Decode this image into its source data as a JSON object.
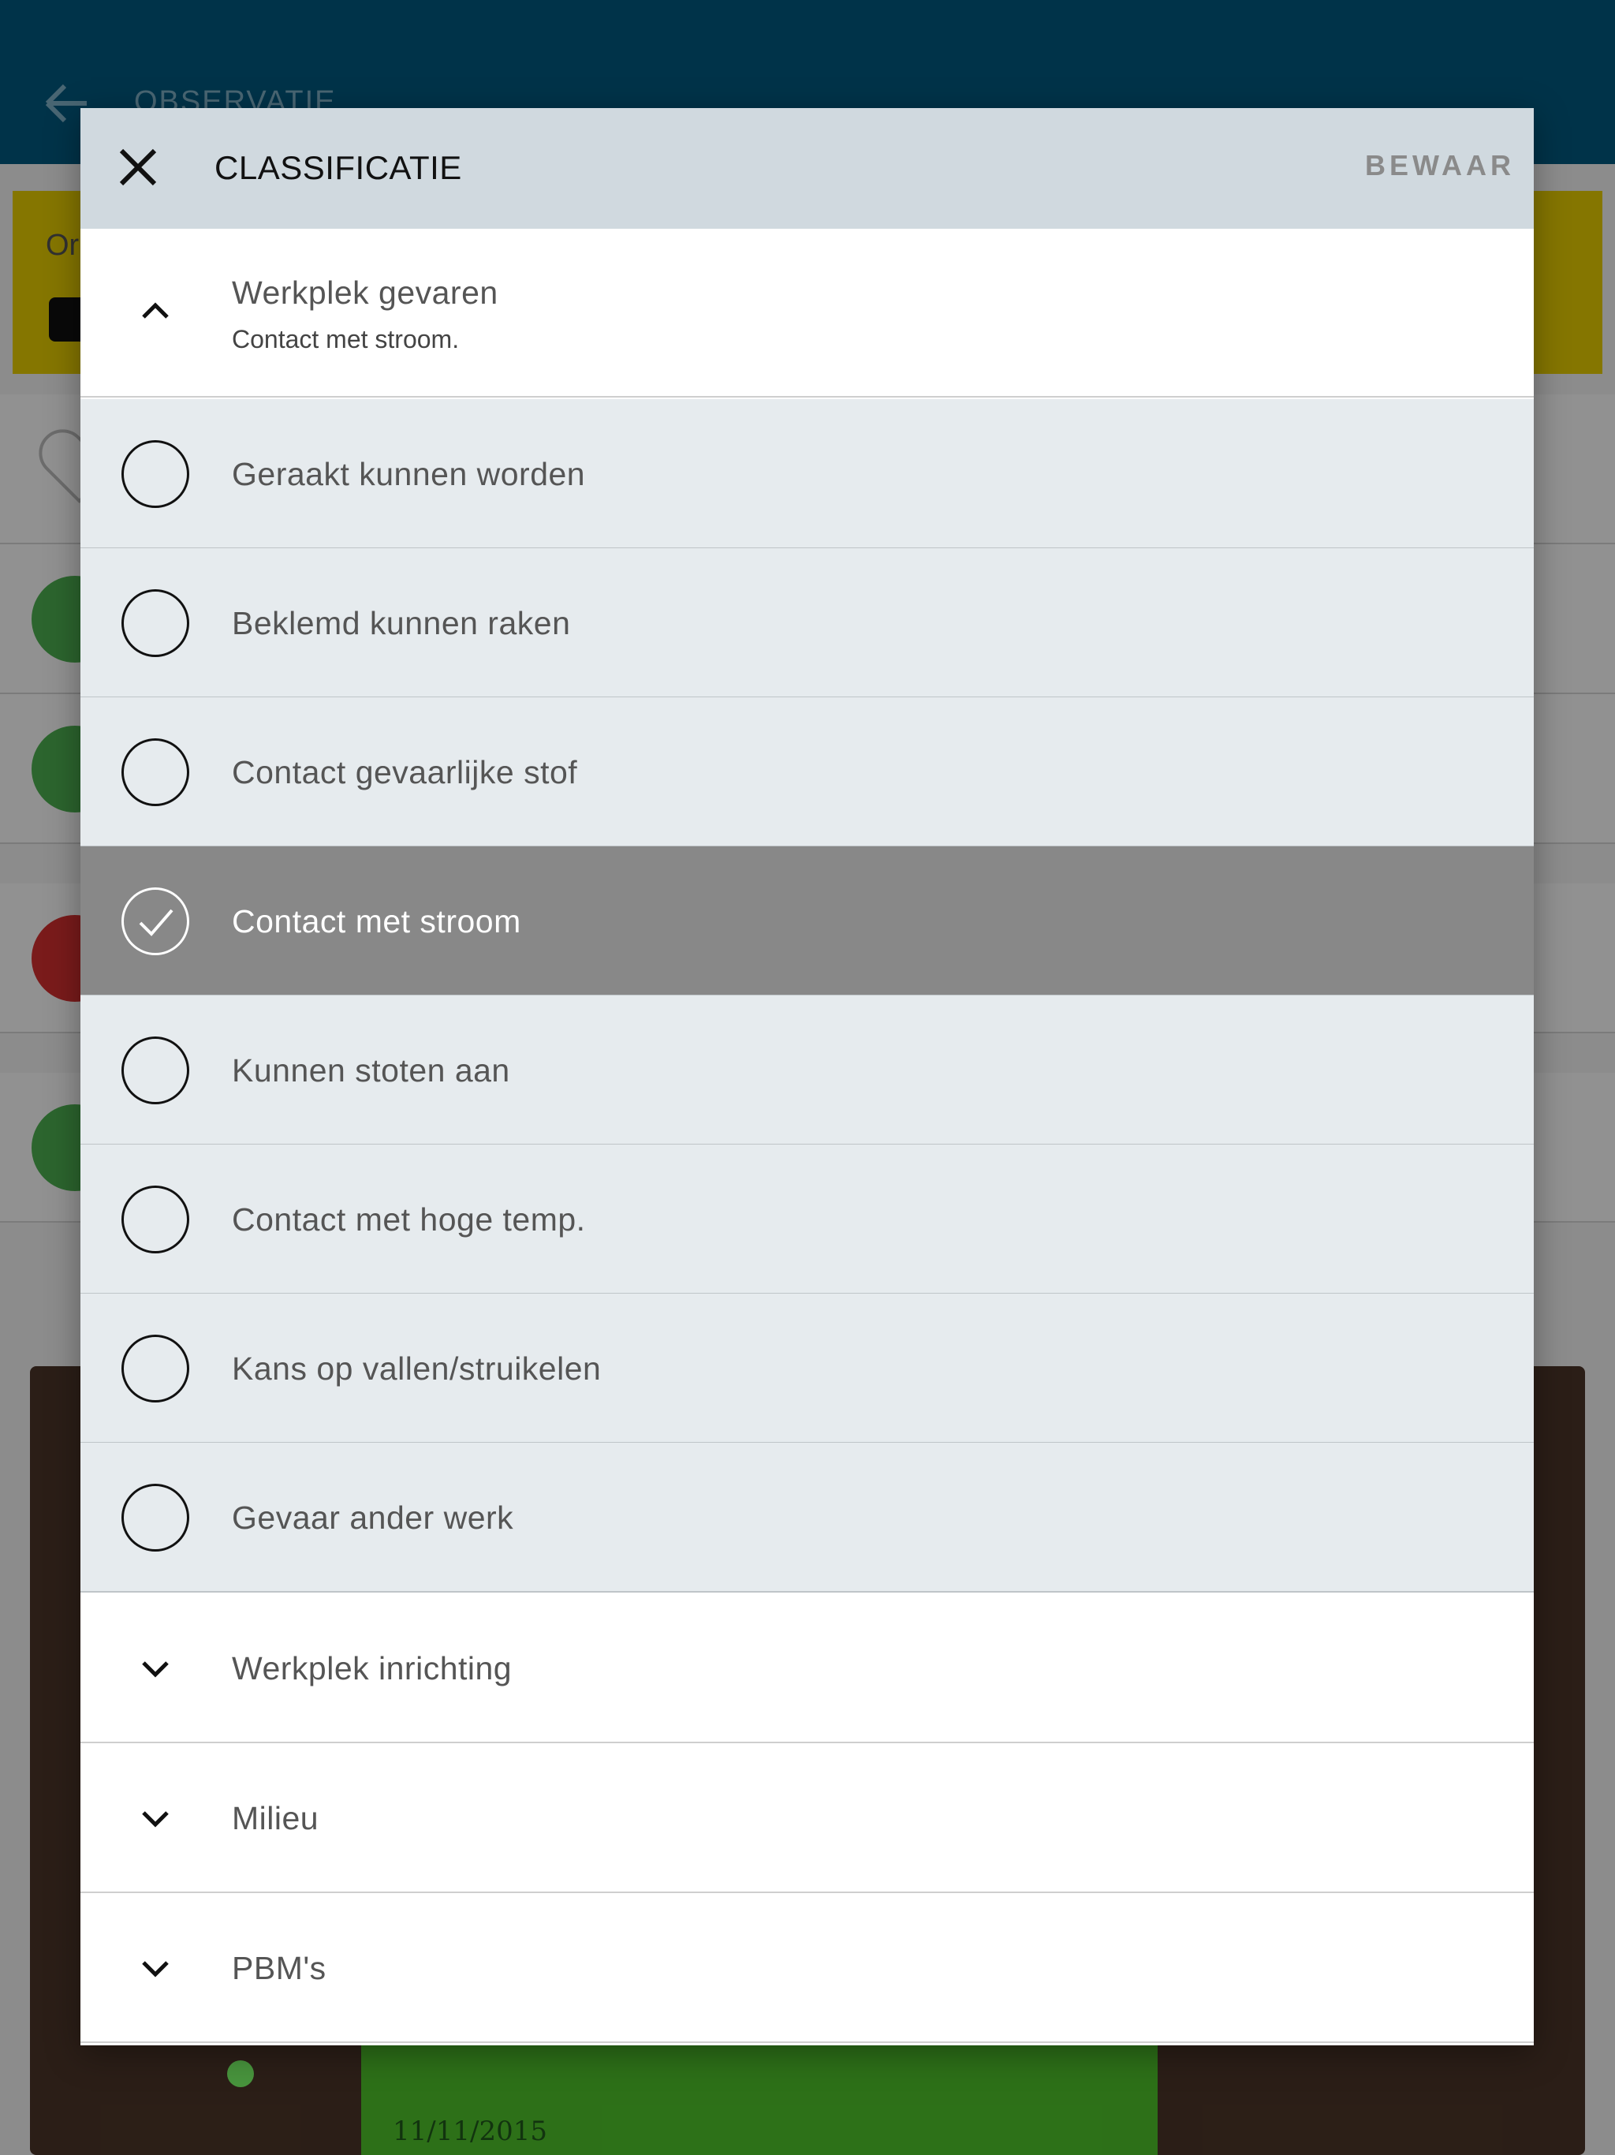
{
  "background": {
    "title": "OBSERVATIE",
    "banner_text": "Or",
    "photo_date": "11/11/2015"
  },
  "dialog": {
    "title": "CLASSIFICATIE",
    "save_label": "BEWAAR",
    "expanded_category": {
      "label": "Werkplek gevaren",
      "selection_summary": "Contact met stroom."
    },
    "options": [
      {
        "label": "Geraakt kunnen worden",
        "selected": false
      },
      {
        "label": "Beklemd kunnen raken",
        "selected": false
      },
      {
        "label": "Contact gevaarlijke stof",
        "selected": false
      },
      {
        "label": "Contact met stroom",
        "selected": true
      },
      {
        "label": "Kunnen stoten aan",
        "selected": false
      },
      {
        "label": "Contact met hoge temp.",
        "selected": false
      },
      {
        "label": "Kans op vallen/struikelen",
        "selected": false
      },
      {
        "label": "Gevaar ander werk",
        "selected": false
      }
    ],
    "collapsed_categories": [
      {
        "label": "Werkplek inrichting"
      },
      {
        "label": "Milieu"
      },
      {
        "label": "PBM's"
      }
    ]
  },
  "colors": {
    "header_bar": "#00587e",
    "dialog_header": "#d0d9df",
    "option_bg": "#e6ebee",
    "selected_bg": "#888888"
  },
  "icons": {
    "close": "close-icon",
    "expanded": "chevron-up-icon",
    "collapsed": "chevron-down-icon",
    "selected": "checkmark-icon"
  }
}
